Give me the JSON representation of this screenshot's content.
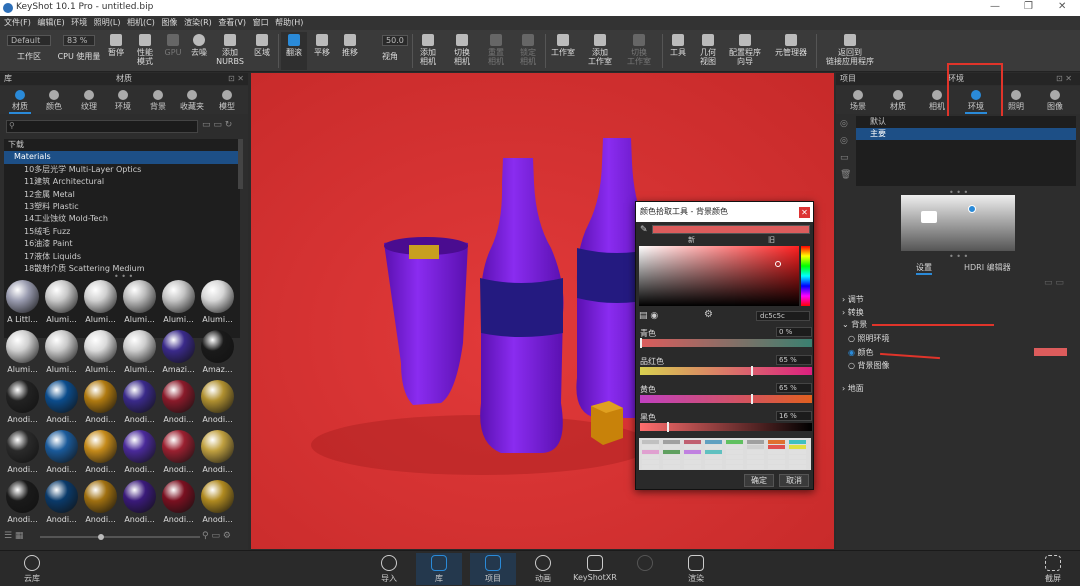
{
  "window": {
    "title": "KeyShot 10.1 Pro - untitled.bip",
    "min": "—",
    "max": "❐",
    "close": "✕"
  },
  "menu": [
    "文件(F)",
    "编辑(E)",
    "环境",
    "照明(L)",
    "相机(C)",
    "图像",
    "渲染(R)",
    "查看(V)",
    "窗口",
    "帮助(H)"
  ],
  "toolbar": {
    "workspace_value": "Default",
    "workspace_label": "工作区",
    "cpu_value": "83 %",
    "cpu_label": "CPU 使用量",
    "pause": "暂停",
    "perf_mode": "性能\n模式",
    "gpu": "GPU",
    "denoise": "去噪",
    "nurbs": "添加\nNURBS",
    "region": "区域",
    "tumble": "翻滚",
    "pan": "平移",
    "dolly": "推移",
    "fov_value": "50.0",
    "fov": "视角",
    "add_camera": "添加\n相机",
    "switch_camera": "切换\n相机",
    "reset_camera": "重置\n相机",
    "lock_camera": "锁定\n相机",
    "studio": "工作室",
    "add_studio": "添加\n工作室",
    "switch_studio": "切换\n工作室",
    "tools": "工具",
    "geometry_view": "几何\n视图",
    "configurator": "配置程序\n向导",
    "element_manager": "元管理器",
    "back_to_app": "返回到\n链接应用程序"
  },
  "library": {
    "title_left": "库",
    "title": "材质",
    "tabs": [
      "材质",
      "颜色",
      "纹理",
      "环境",
      "背景",
      "收藏夹",
      "模型"
    ],
    "tree": [
      "下载",
      "Materials",
      "10多层光学 Multi-Layer Optics",
      "11建筑 Architectural",
      "12金属 Metal",
      "13塑料 Plastic",
      "14工业蚀纹 Mold-Tech",
      "15绒毛 Fuzz",
      "16油漆 Paint",
      "17液体 Liquids",
      "18散射介质 Scattering Medium"
    ],
    "thumbs": [
      "A Littl...",
      "Alumi...",
      "Alumi...",
      "Alumi...",
      "Alumi...",
      "Alumi...",
      "Alumi...",
      "Alumi...",
      "Alumi...",
      "Alumi...",
      "Amazi...",
      "Amaz...",
      "Anodi...",
      "Anodi...",
      "Anodi...",
      "Anodi...",
      "Anodi...",
      "Anodi...",
      "Anodi...",
      "Anodi...",
      "Anodi...",
      "Anodi...",
      "Anodi...",
      "Anodi...",
      "Anodi...",
      "Anodi...",
      "Anodi...",
      "Anodi...",
      "Anodi...",
      "Anodi..."
    ],
    "thumb_colors": [
      "#9a9cb0",
      "#c8c8c8",
      "#d0d0d0",
      "#bcbcbc",
      "#c4c4c4",
      "#d6d6d6",
      "#cfcfcf",
      "#c9c9c9",
      "#dadada",
      "#cdcdcd",
      "#3a2a8a",
      "#1a1a1a",
      "#222222",
      "#0b4c8c",
      "#b07a10",
      "#3a2a8a",
      "#8a1a2a",
      "#b09030",
      "#2a2a2a",
      "#1a5a9a",
      "#c48a1a",
      "#4a2a9a",
      "#9a2030",
      "#c0a040",
      "#1a1a1a",
      "#0a3a6a",
      "#a07010",
      "#3a1a7a",
      "#7a1020",
      "#b08a20"
    ]
  },
  "colorpicker": {
    "title": "颜色拾取工具 - 背景颜色",
    "new": "新",
    "old": "旧",
    "hex": "dc5c5c",
    "c_label": "青色",
    "c_val": "0 %",
    "m_label": "品红色",
    "m_val": "65 %",
    "y_label": "黄色",
    "y_val": "65 %",
    "k_label": "黑色",
    "k_val": "16 %",
    "ok": "确定",
    "cancel": "取消",
    "swatches": [
      "#c0c0c0",
      "#a0a0a0",
      "#c06070",
      "#60a0c0",
      "#60c060",
      "#a0a0a0",
      "#e07030",
      "#40c0c0",
      "#e0e0e0",
      "#e0e0e0",
      "#e0e0e0",
      "#e0e0e0",
      "#e0e0e0",
      "#d0d0d0",
      "#e05050",
      "#e0e040",
      "#e0a0d0",
      "#60a060",
      "#c080e0",
      "#60c0c0",
      "#e0e0e0",
      "#e0e0e0",
      "#e0e0e0",
      "#e0e0e0",
      "#e0e0e0",
      "#e0e0e0",
      "#e0e0e0",
      "#e0e0e0",
      "#e0e0e0",
      "#e0e0e0",
      "#e0e0e0",
      "#e0e0e0",
      "#e0e0e0",
      "#e0e0e0",
      "#e0e0e0",
      "#e0e0e0",
      "#e0e0e0",
      "#e0e0e0",
      "#e0e0e0",
      "#e0e0e0",
      "#e0e0e0",
      "#e0e0e0",
      "#e0e0e0",
      "#e0e0e0",
      "#e0e0e0",
      "#e0e0e0",
      "#e0e0e0",
      "#e0e0e0"
    ],
    "background_color": "#dc5c5c"
  },
  "project": {
    "title": "项目",
    "env_title": "环境",
    "tabs": [
      "场景",
      "材质",
      "相机",
      "环境",
      "照明",
      "图像"
    ],
    "envs": [
      "默认",
      "主要"
    ],
    "settings_tab": "设置",
    "hdri_tab": "HDRI 编辑器",
    "sections": [
      "调节",
      "转换",
      "背景",
      "地面"
    ],
    "bg_options": [
      "照明环境",
      "颜色",
      "背景图像"
    ],
    "bg_color": "#dc5c5c"
  },
  "bottom": {
    "cloud": "云库",
    "import": "导入",
    "library": "库",
    "project": "项目",
    "animation": "动画",
    "keyshotxr": "KeyShotXR",
    "render_btn": "渲染",
    "screenshot": "截屏"
  },
  "colors": {
    "accent": "#2a8ad8",
    "viewport_bg": "#dd3535",
    "bottle": "#7a1fe0",
    "highlight": "#e0342a"
  }
}
